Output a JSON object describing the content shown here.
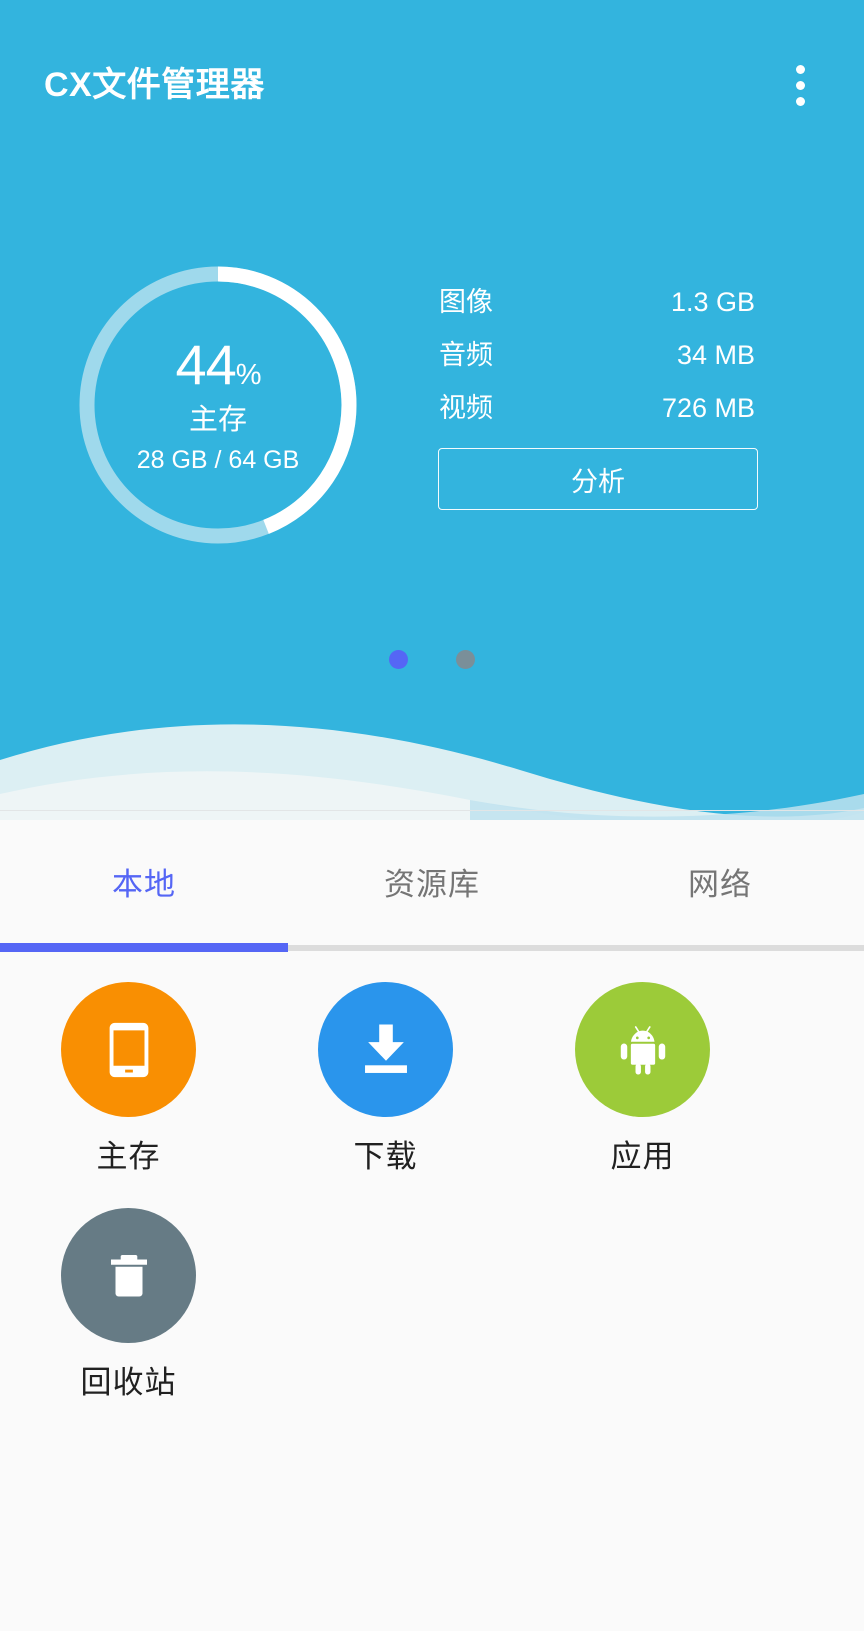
{
  "app": {
    "title": "CX文件管理器",
    "header_color": "#33b4de",
    "accent_color": "#5566f5"
  },
  "appbar": {
    "overflow_icon": "more-vert-icon"
  },
  "storage": {
    "percent_value": "44",
    "percent_symbol": "%",
    "label": "主存",
    "used_total": "28 GB / 64 GB",
    "used_fraction": 0.44,
    "ring_track_color": "#9fd9ec",
    "ring_fill_color": "#ffffff"
  },
  "stats": {
    "rows": [
      {
        "name": "图像",
        "value": "1.3 GB"
      },
      {
        "name": "音频",
        "value": "34 MB"
      },
      {
        "name": "视频",
        "value": "726 MB"
      }
    ],
    "analyze_label": "分析"
  },
  "pager": {
    "dots": [
      {
        "state": "active"
      },
      {
        "state": "inactive"
      }
    ],
    "active_color": "#5566f5",
    "inactive_color": "#7a8f99"
  },
  "tabs": [
    {
      "label": "本地",
      "active": true
    },
    {
      "label": "资源库",
      "active": false
    },
    {
      "label": "网络",
      "active": false
    }
  ],
  "shortcuts": [
    {
      "label": "主存",
      "icon": "tablet-icon",
      "color": "#f98f02"
    },
    {
      "label": "下载",
      "icon": "download-icon",
      "color": "#2a95ec"
    },
    {
      "label": "应用",
      "icon": "android-icon",
      "color": "#9ccb39"
    },
    {
      "label": "回收站",
      "icon": "trash-icon",
      "color": "#667b85"
    }
  ]
}
